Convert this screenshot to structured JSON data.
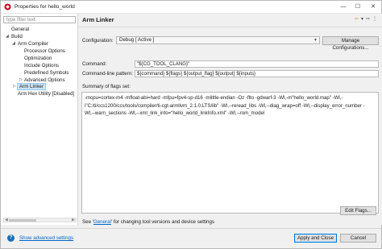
{
  "window": {
    "title": "Properties for hello_world",
    "controls": {
      "minimize": "—",
      "maximize": "☐",
      "close": "✕"
    }
  },
  "left_pane": {
    "filter_placeholder": "type filter text",
    "tree": [
      {
        "label": "General",
        "level": 0,
        "expanded": null
      },
      {
        "label": "Build",
        "level": 0,
        "expanded": true
      },
      {
        "label": "Arm Compiler",
        "level": 1,
        "expanded": true
      },
      {
        "label": "Processor Options",
        "level": 2
      },
      {
        "label": "Optimization",
        "level": 2
      },
      {
        "label": "Include Options",
        "level": 2
      },
      {
        "label": "Predefined Symbols",
        "level": 2
      },
      {
        "label": "Advanced Options",
        "level": 2,
        "expanded": false
      },
      {
        "label": "Arm Linker",
        "level": 1,
        "expanded": false,
        "selected": true
      },
      {
        "label": "Arm Hex Utility  [Disabled]",
        "level": 1
      }
    ]
  },
  "right_pane": {
    "page_title": "Arm Linker",
    "nav_icons": [
      "back-arrow-icon",
      "menu-down-icon",
      "forward-arrow-icon",
      "more-icon"
    ],
    "configuration_label": "Configuration:",
    "configuration_value": "Debug  [ Active ]",
    "manage_configurations_button": "Manage Configurations...",
    "command_label": "Command:",
    "command_value": "\"${CG_TOOL_CLANG}\"",
    "command_pattern_label": "Command-line pattern:",
    "command_pattern_value": "${command} ${flags} ${output_flag} ${output} ${inputs}",
    "summary_label": "Summary of flags set:",
    "summary_lines": [
      "-mcpu=cortex-m4 -mfloat-abi=hard -mfpu=fpv4-sp-d16 -mlittle-endian -Oz -flto -gdwarf-3 -Wl,-m\"hello_world.map\" -Wl,-",
      "i\"C:/ti/ccs1200/ccs/tools/compiler/ti-cgt-armllvm_2.1.0.LTS/lib\" -Wl,--reread_libs -Wl,--diag_wrap=off -Wl,--display_error_number -",
      "Wl,--warn_sections -Wl,--xml_link_info=\"hello_world_linkInfo.xml\" -Wl,--rom_model"
    ],
    "edit_flags_button": "Edit Flags...",
    "hint_prefix": "See '",
    "hint_link": "General",
    "hint_suffix": "' for changing tool versions and device settings"
  },
  "footer": {
    "help_icon_label": "?",
    "show_advanced_settings": "Show advanced settings",
    "apply_close_button": "Apply and Close",
    "cancel_button": "Cancel"
  },
  "colors": {
    "selection": "#cce4f7",
    "link": "#0066cc",
    "primary_border": "#0078d7"
  }
}
